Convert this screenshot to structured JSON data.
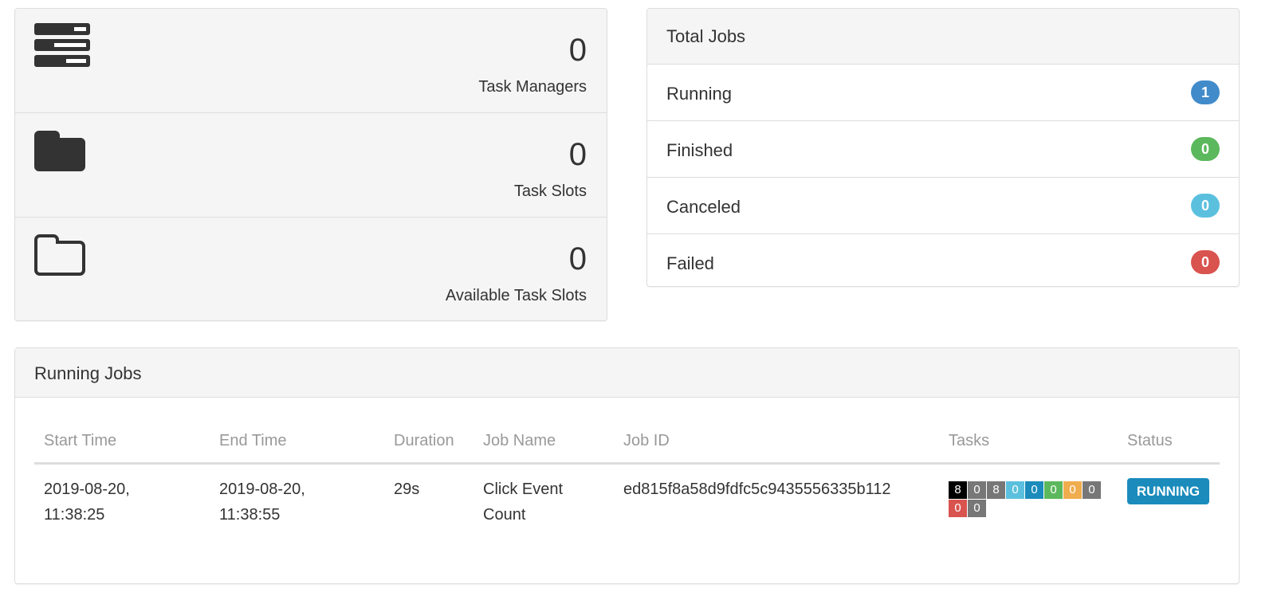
{
  "overview": [
    {
      "icon": "server-icon",
      "value": "0",
      "label": "Task Managers"
    },
    {
      "icon": "folder-solid-icon",
      "value": "0",
      "label": "Task Slots"
    },
    {
      "icon": "folder-outline-icon",
      "value": "0",
      "label": "Available Task Slots"
    }
  ],
  "total_jobs": {
    "title": "Total Jobs",
    "rows": [
      {
        "label": "Running",
        "count": "1",
        "color": "#428bca"
      },
      {
        "label": "Finished",
        "count": "0",
        "color": "#5cb85c"
      },
      {
        "label": "Canceled",
        "count": "0",
        "color": "#5bc0de"
      },
      {
        "label": "Failed",
        "count": "0",
        "color": "#d9534f"
      }
    ]
  },
  "running_jobs": {
    "title": "Running Jobs",
    "columns": [
      "Start Time",
      "End Time",
      "Duration",
      "Job Name",
      "Job ID",
      "Tasks",
      "Status"
    ],
    "rows": [
      {
        "start": "2019-08-20,",
        "start2": "11:38:25",
        "end": "2019-08-20,",
        "end2": "11:38:55",
        "duration": "29s",
        "name": "Click Event",
        "name2": "Count",
        "id": "ed815f8a58d9fdfc5c9435556335b112",
        "tasks": [
          {
            "v": "8",
            "c": "#000"
          },
          {
            "v": "0",
            "c": "#777"
          },
          {
            "v": "8",
            "c": "#777"
          },
          {
            "v": "0",
            "c": "#5bc0de"
          },
          {
            "v": "0",
            "c": "#1a8bbb"
          },
          {
            "v": "0",
            "c": "#5cb85c"
          },
          {
            "v": "0",
            "c": "#f0ad4e"
          },
          {
            "v": "0",
            "c": "#777"
          },
          {
            "v": "0",
            "c": "#d9534f"
          },
          {
            "v": "0",
            "c": "#777"
          }
        ],
        "status": "RUNNING"
      }
    ]
  }
}
